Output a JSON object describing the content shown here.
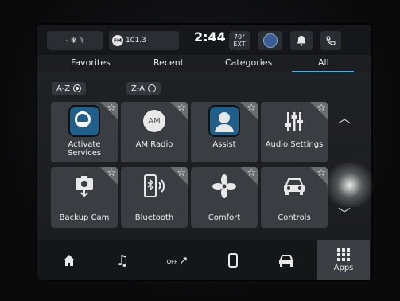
{
  "status": {
    "radio_station": "101.3",
    "fm_badge": "FM",
    "clock": "2:44",
    "temperature": "70°",
    "temperature_unit": "EXT"
  },
  "tabs": [
    {
      "label": "Favorites"
    },
    {
      "label": "Recent"
    },
    {
      "label": "Categories"
    },
    {
      "label": "All",
      "active": true
    }
  ],
  "sort": {
    "az": "A-Z",
    "za": "Z-A",
    "selected": "A-Z"
  },
  "apps": [
    {
      "label_line1": "Activate",
      "label_line2": "Services",
      "icon": "connected-services-icon"
    },
    {
      "label_line1": "AM Radio",
      "label_line2": "",
      "icon": "am-radio-icon",
      "icon_text": "AM"
    },
    {
      "label_line1": "Assist",
      "label_line2": "",
      "icon": "assist-person-icon"
    },
    {
      "label_line1": "Audio Settings",
      "label_line2": "",
      "icon": "audio-sliders-icon"
    },
    {
      "label_line1": "Backup Cam",
      "label_line2": "",
      "icon": "backup-camera-icon"
    },
    {
      "label_line1": "Bluetooth",
      "label_line2": "",
      "icon": "bluetooth-phone-icon"
    },
    {
      "label_line1": "Comfort",
      "label_line2": "",
      "icon": "fan-icon"
    },
    {
      "label_line1": "Controls",
      "label_line2": "",
      "icon": "car-controls-icon"
    }
  ],
  "bottom_nav": {
    "climate_off": "OFF",
    "apps_label": "Apps"
  },
  "colors": {
    "accent": "#3db4e6",
    "tile": "#3a3d41"
  }
}
